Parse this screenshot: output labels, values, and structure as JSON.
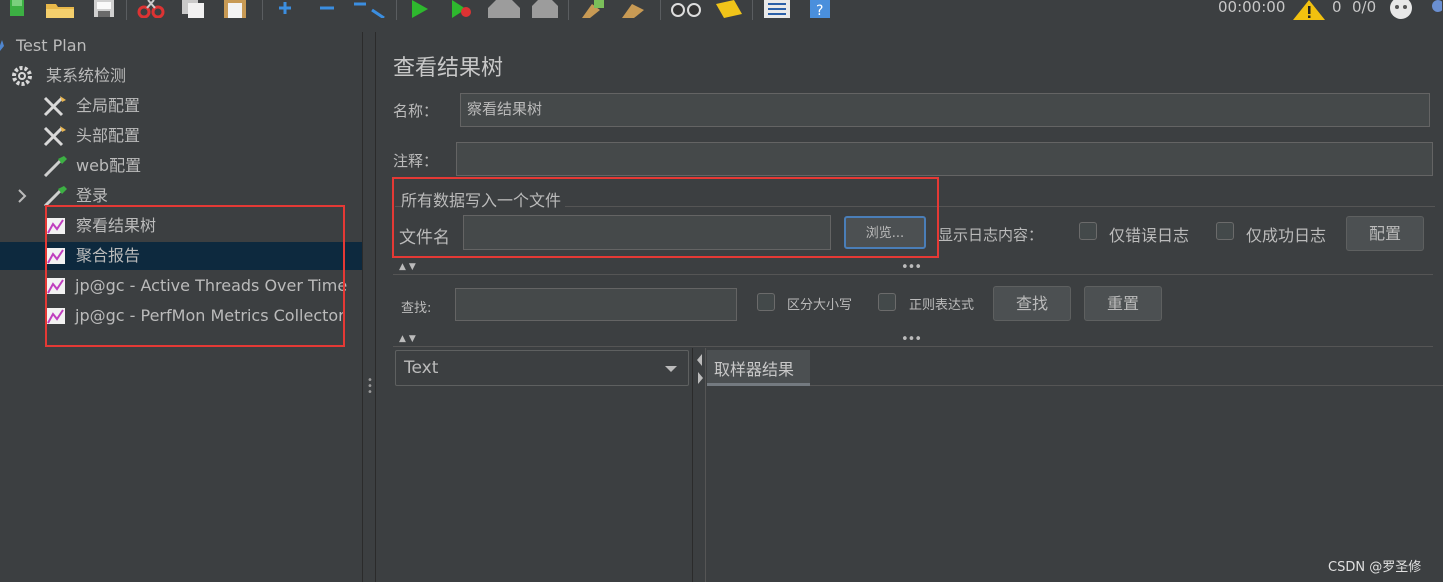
{
  "toolbar": {
    "icons": [
      "new-icon",
      "open-icon",
      "save-icon",
      "cut-icon",
      "copy-icon",
      "paste-icon",
      "expand-icon",
      "collapse-icon",
      "toggle-icon",
      "start-icon",
      "start-no-pause-icon",
      "stop-icon",
      "shutdown-icon",
      "clear-icon",
      "clear-all-icon",
      "search-icon",
      "reset-search-icon",
      "function-helper-icon",
      "help-icon"
    ],
    "elapsed_time": "00:00:00",
    "warning_count": "0",
    "threads": "0/0"
  },
  "tree": {
    "items": [
      {
        "label": "Test Plan",
        "icon": "test-plan-icon"
      },
      {
        "label": "某系统检测",
        "icon": "gear-icon"
      },
      {
        "label": "全局配置",
        "icon": "wrench-icon"
      },
      {
        "label": "头部配置",
        "icon": "wrench-icon"
      },
      {
        "label": "web配置",
        "icon": "pipette-icon"
      },
      {
        "label": "登录",
        "icon": "pipette-icon"
      },
      {
        "label": "察看结果树",
        "icon": "listener-chart-icon"
      },
      {
        "label": "聚合报告",
        "icon": "listener-chart-icon"
      },
      {
        "label": "jp@gc - Active Threads Over Time",
        "icon": "listener-chart-icon"
      },
      {
        "label": "jp@gc - PerfMon Metrics Collector",
        "icon": "listener-chart-icon"
      }
    ]
  },
  "panel": {
    "title": "查看结果树",
    "name_label": "名称：",
    "name_value": "察看结果树",
    "comment_label": "注释：",
    "comment_value": "",
    "file_section_title": "所有数据写入一个文件",
    "filename_label": "文件名",
    "filename_value": "",
    "browse_button": "浏览...",
    "log_display_label": "显示日志内容：",
    "errors_only_label": "仅错误日志",
    "success_only_label": "仅成功日志",
    "configure_button": "配置",
    "search_label": "查找:",
    "search_value": "",
    "case_sensitive_label": "区分大小写",
    "regex_label": "正则表达式",
    "find_button": "查找",
    "reset_button": "重置",
    "renderer_selected": "Text",
    "result_tab": "取样器结果"
  },
  "watermark": "CSDN @罗圣修",
  "colors": {
    "background": "#3c3f41",
    "selection": "#0d293e",
    "highlight_border": "#e53935",
    "text": "#bbbbbb"
  }
}
